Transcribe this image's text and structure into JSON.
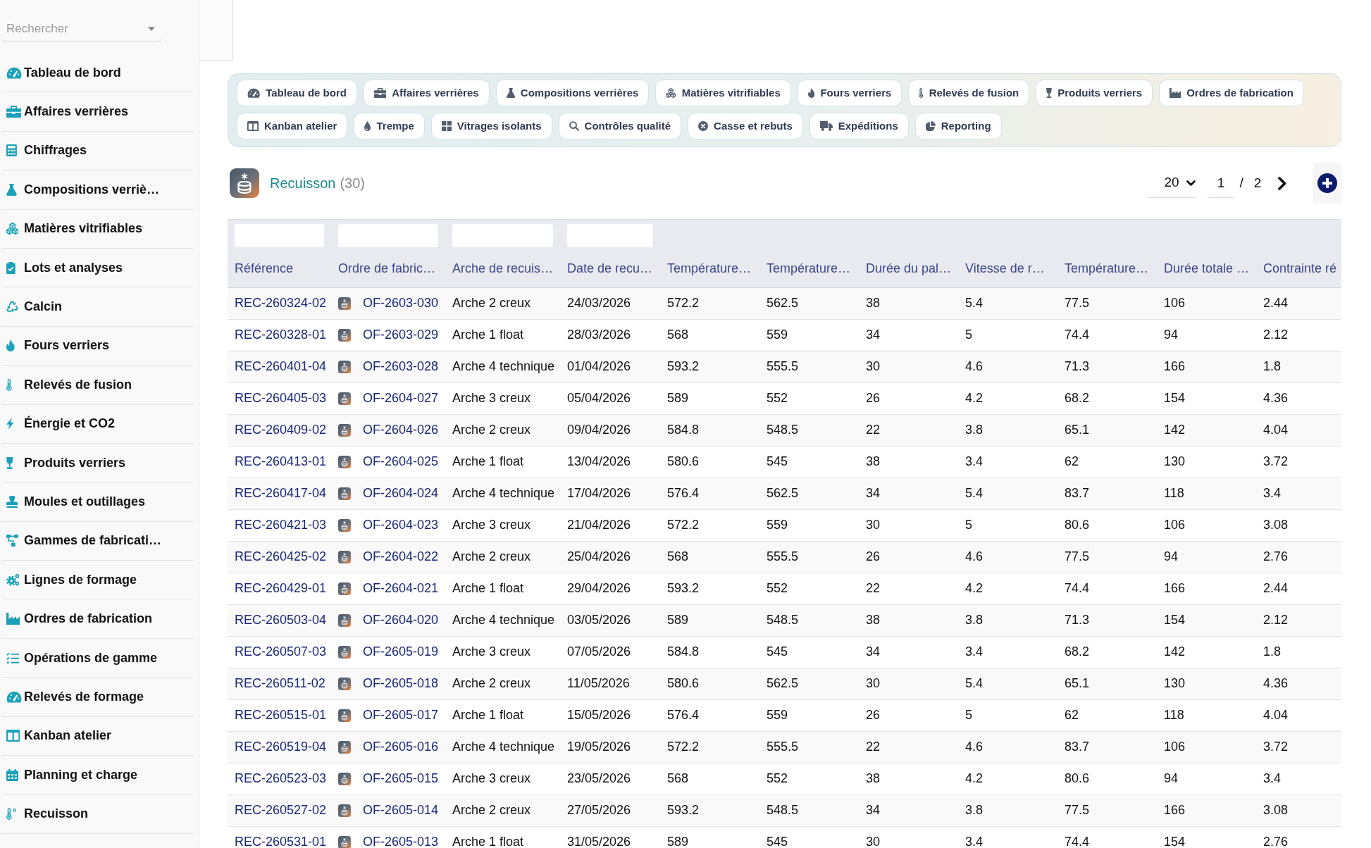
{
  "sidebar": {
    "search": {
      "placeholder": "Rechercher"
    },
    "items": [
      "Tableau de bord",
      "Affaires verrières",
      "Chiffrages",
      "Compositions verriè…",
      "Matières vitrifiables",
      "Lots et analyses",
      "Calcin",
      "Fours verriers",
      "Relevés de fusion",
      "Énergie et CO2",
      "Produits verriers",
      "Moules et outillages",
      "Gammes de fabricati…",
      "Lignes de formage",
      "Ordres de fabrication",
      "Opérations de gamme",
      "Relevés de formage",
      "Kanban atelier",
      "Planning et charge",
      "Recuisson"
    ]
  },
  "tabs": [
    "Tableau de bord",
    "Affaires verrières",
    "Compositions verrières",
    "Matières vitrifiables",
    "Fours verriers",
    "Relevés de fusion",
    "Produits verriers",
    "Ordres de fabrication",
    "Kanban atelier",
    "Trempe",
    "Vitrages isolants",
    "Contrôles qualité",
    "Casse et rebuts",
    "Expéditions",
    "Reporting"
  ],
  "header": {
    "title": "Recuisson",
    "count": "(30)"
  },
  "pagination": {
    "page_size": "20",
    "page": "1",
    "separator": "/",
    "pages": "2"
  },
  "table": {
    "columns": [
      {
        "label": "Référence",
        "kind": "link",
        "filter": true
      },
      {
        "label": "Ordre de fabric…",
        "kind": "record",
        "filter": true
      },
      {
        "label": "Arche de recuis…",
        "kind": "text",
        "filter": true
      },
      {
        "label": "Date de recu…",
        "kind": "text",
        "filter": true
      },
      {
        "label": "Température…",
        "kind": "text",
        "filter": false
      },
      {
        "label": "Température…",
        "kind": "text",
        "filter": false
      },
      {
        "label": "Durée du pal…",
        "kind": "text",
        "filter": false
      },
      {
        "label": "Vitesse de r…",
        "kind": "text",
        "filter": false
      },
      {
        "label": "Température…",
        "kind": "text",
        "filter": false
      },
      {
        "label": "Durée totale …",
        "kind": "text",
        "filter": false
      },
      {
        "label": "Contrainte ré",
        "kind": "text",
        "filter": false
      }
    ],
    "rows": [
      [
        "REC-260324-02",
        "OF-2603-030",
        "Arche 2 creux",
        "24/03/2026",
        "572.2",
        "562.5",
        "38",
        "5.4",
        "77.5",
        "106",
        "2.44"
      ],
      [
        "REC-260328-01",
        "OF-2603-029",
        "Arche 1 float",
        "28/03/2026",
        "568",
        "559",
        "34",
        "5",
        "74.4",
        "94",
        "2.12"
      ],
      [
        "REC-260401-04",
        "OF-2603-028",
        "Arche 4 technique",
        "01/04/2026",
        "593.2",
        "555.5",
        "30",
        "4.6",
        "71.3",
        "166",
        "1.8"
      ],
      [
        "REC-260405-03",
        "OF-2604-027",
        "Arche 3 creux",
        "05/04/2026",
        "589",
        "552",
        "26",
        "4.2",
        "68.2",
        "154",
        "4.36"
      ],
      [
        "REC-260409-02",
        "OF-2604-026",
        "Arche 2 creux",
        "09/04/2026",
        "584.8",
        "548.5",
        "22",
        "3.8",
        "65.1",
        "142",
        "4.04"
      ],
      [
        "REC-260413-01",
        "OF-2604-025",
        "Arche 1 float",
        "13/04/2026",
        "580.6",
        "545",
        "38",
        "3.4",
        "62",
        "130",
        "3.72"
      ],
      [
        "REC-260417-04",
        "OF-2604-024",
        "Arche 4 technique",
        "17/04/2026",
        "576.4",
        "562.5",
        "34",
        "5.4",
        "83.7",
        "118",
        "3.4"
      ],
      [
        "REC-260421-03",
        "OF-2604-023",
        "Arche 3 creux",
        "21/04/2026",
        "572.2",
        "559",
        "30",
        "5",
        "80.6",
        "106",
        "3.08"
      ],
      [
        "REC-260425-02",
        "OF-2604-022",
        "Arche 2 creux",
        "25/04/2026",
        "568",
        "555.5",
        "26",
        "4.6",
        "77.5",
        "94",
        "2.76"
      ],
      [
        "REC-260429-01",
        "OF-2604-021",
        "Arche 1 float",
        "29/04/2026",
        "593.2",
        "552",
        "22",
        "4.2",
        "74.4",
        "166",
        "2.44"
      ],
      [
        "REC-260503-04",
        "OF-2604-020",
        "Arche 4 technique",
        "03/05/2026",
        "589",
        "548.5",
        "38",
        "3.8",
        "71.3",
        "154",
        "2.12"
      ],
      [
        "REC-260507-03",
        "OF-2605-019",
        "Arche 3 creux",
        "07/05/2026",
        "584.8",
        "545",
        "34",
        "3.4",
        "68.2",
        "142",
        "1.8"
      ],
      [
        "REC-260511-02",
        "OF-2605-018",
        "Arche 2 creux",
        "11/05/2026",
        "580.6",
        "562.5",
        "30",
        "5.4",
        "65.1",
        "130",
        "4.36"
      ],
      [
        "REC-260515-01",
        "OF-2605-017",
        "Arche 1 float",
        "15/05/2026",
        "576.4",
        "559",
        "26",
        "5",
        "62",
        "118",
        "4.04"
      ],
      [
        "REC-260519-04",
        "OF-2605-016",
        "Arche 4 technique",
        "19/05/2026",
        "572.2",
        "555.5",
        "22",
        "4.6",
        "83.7",
        "106",
        "3.72"
      ],
      [
        "REC-260523-03",
        "OF-2605-015",
        "Arche 3 creux",
        "23/05/2026",
        "568",
        "552",
        "38",
        "4.2",
        "80.6",
        "94",
        "3.4"
      ],
      [
        "REC-260527-02",
        "OF-2605-014",
        "Arche 2 creux",
        "27/05/2026",
        "593.2",
        "548.5",
        "34",
        "3.8",
        "77.5",
        "166",
        "3.08"
      ],
      [
        "REC-260531-01",
        "OF-2605-013",
        "Arche 1 float",
        "31/05/2026",
        "589",
        "545",
        "30",
        "3.4",
        "74.4",
        "154",
        "2.76"
      ]
    ]
  }
}
